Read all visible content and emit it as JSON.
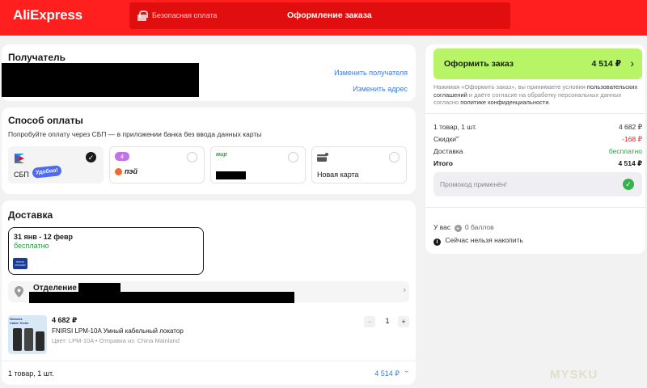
{
  "header": {
    "logo": "AliExpress",
    "secure_payment": "Безопасная оплата",
    "page_title": "Оформление заказа",
    "brand_color": "#ff1f1f"
  },
  "recipient": {
    "title": "Получатель",
    "change_recipient": "Изменить получателя",
    "change_address": "Изменить адрес"
  },
  "payment": {
    "title": "Способ оплаты",
    "hint": "Попробуйте оплату через СБП — в приложении банка без ввода данных карты",
    "options": [
      {
        "label": "СБП",
        "badge": "Удобно!",
        "selected": true,
        "icon": "sbp-icon"
      },
      {
        "label": "пэй",
        "badge": "4",
        "selected": false,
        "icon": "bank-icon"
      },
      {
        "label": "мир",
        "selected": false,
        "icon": "mir-card-icon"
      },
      {
        "label": "Новая карта",
        "selected": false,
        "icon": "new-card-icon"
      }
    ]
  },
  "delivery": {
    "title": "Доставка",
    "date_range": "31 янв - 12 февр",
    "price": "бесплатно",
    "carrier_logo": "ПОЧТА РОССИИ",
    "office_label": "Отделение",
    "product": {
      "price": "4 682 ₽",
      "name": "FNIRSI LPM-10A Умный кабельный локатор",
      "variant": "Цвет: LPM-10A • Отправка из: China Mainland",
      "thumb_text": "Network Cable Tester",
      "quantity": "1"
    },
    "footer_count": "1 товар, 1 шт.",
    "footer_total": "4 514 ₽"
  },
  "summary": {
    "order_button": "Оформить заказ",
    "order_total": "4 514 ₽",
    "consent_1": "Нажимая «Оформить заказ», вы принимаете условия ",
    "consent_link_1": "пользовательских соглашений",
    "consent_2": " и даёте согласие на обработку персональных данных согласно ",
    "consent_link_2": "политике конфиденциальности",
    "consent_3": ".",
    "rows": [
      {
        "label": "1 товар, 1 шт.",
        "value": "4 682 ₽"
      },
      {
        "label": "Скидки",
        "value": "-168 ₽"
      },
      {
        "label": "Доставка",
        "value": "бесплатно"
      },
      {
        "label": "Итого",
        "value": "4 514 ₽"
      }
    ],
    "promo": "Промокод применён!",
    "points_prefix": "У вас",
    "points": "0 баллов",
    "cant_accumulate": "Сейчас нельзя накопить",
    "button_color": "#b8f566",
    "discount_color": "#e8242a",
    "free_color": "#2a9d3f"
  },
  "watermark": "MYSKU"
}
